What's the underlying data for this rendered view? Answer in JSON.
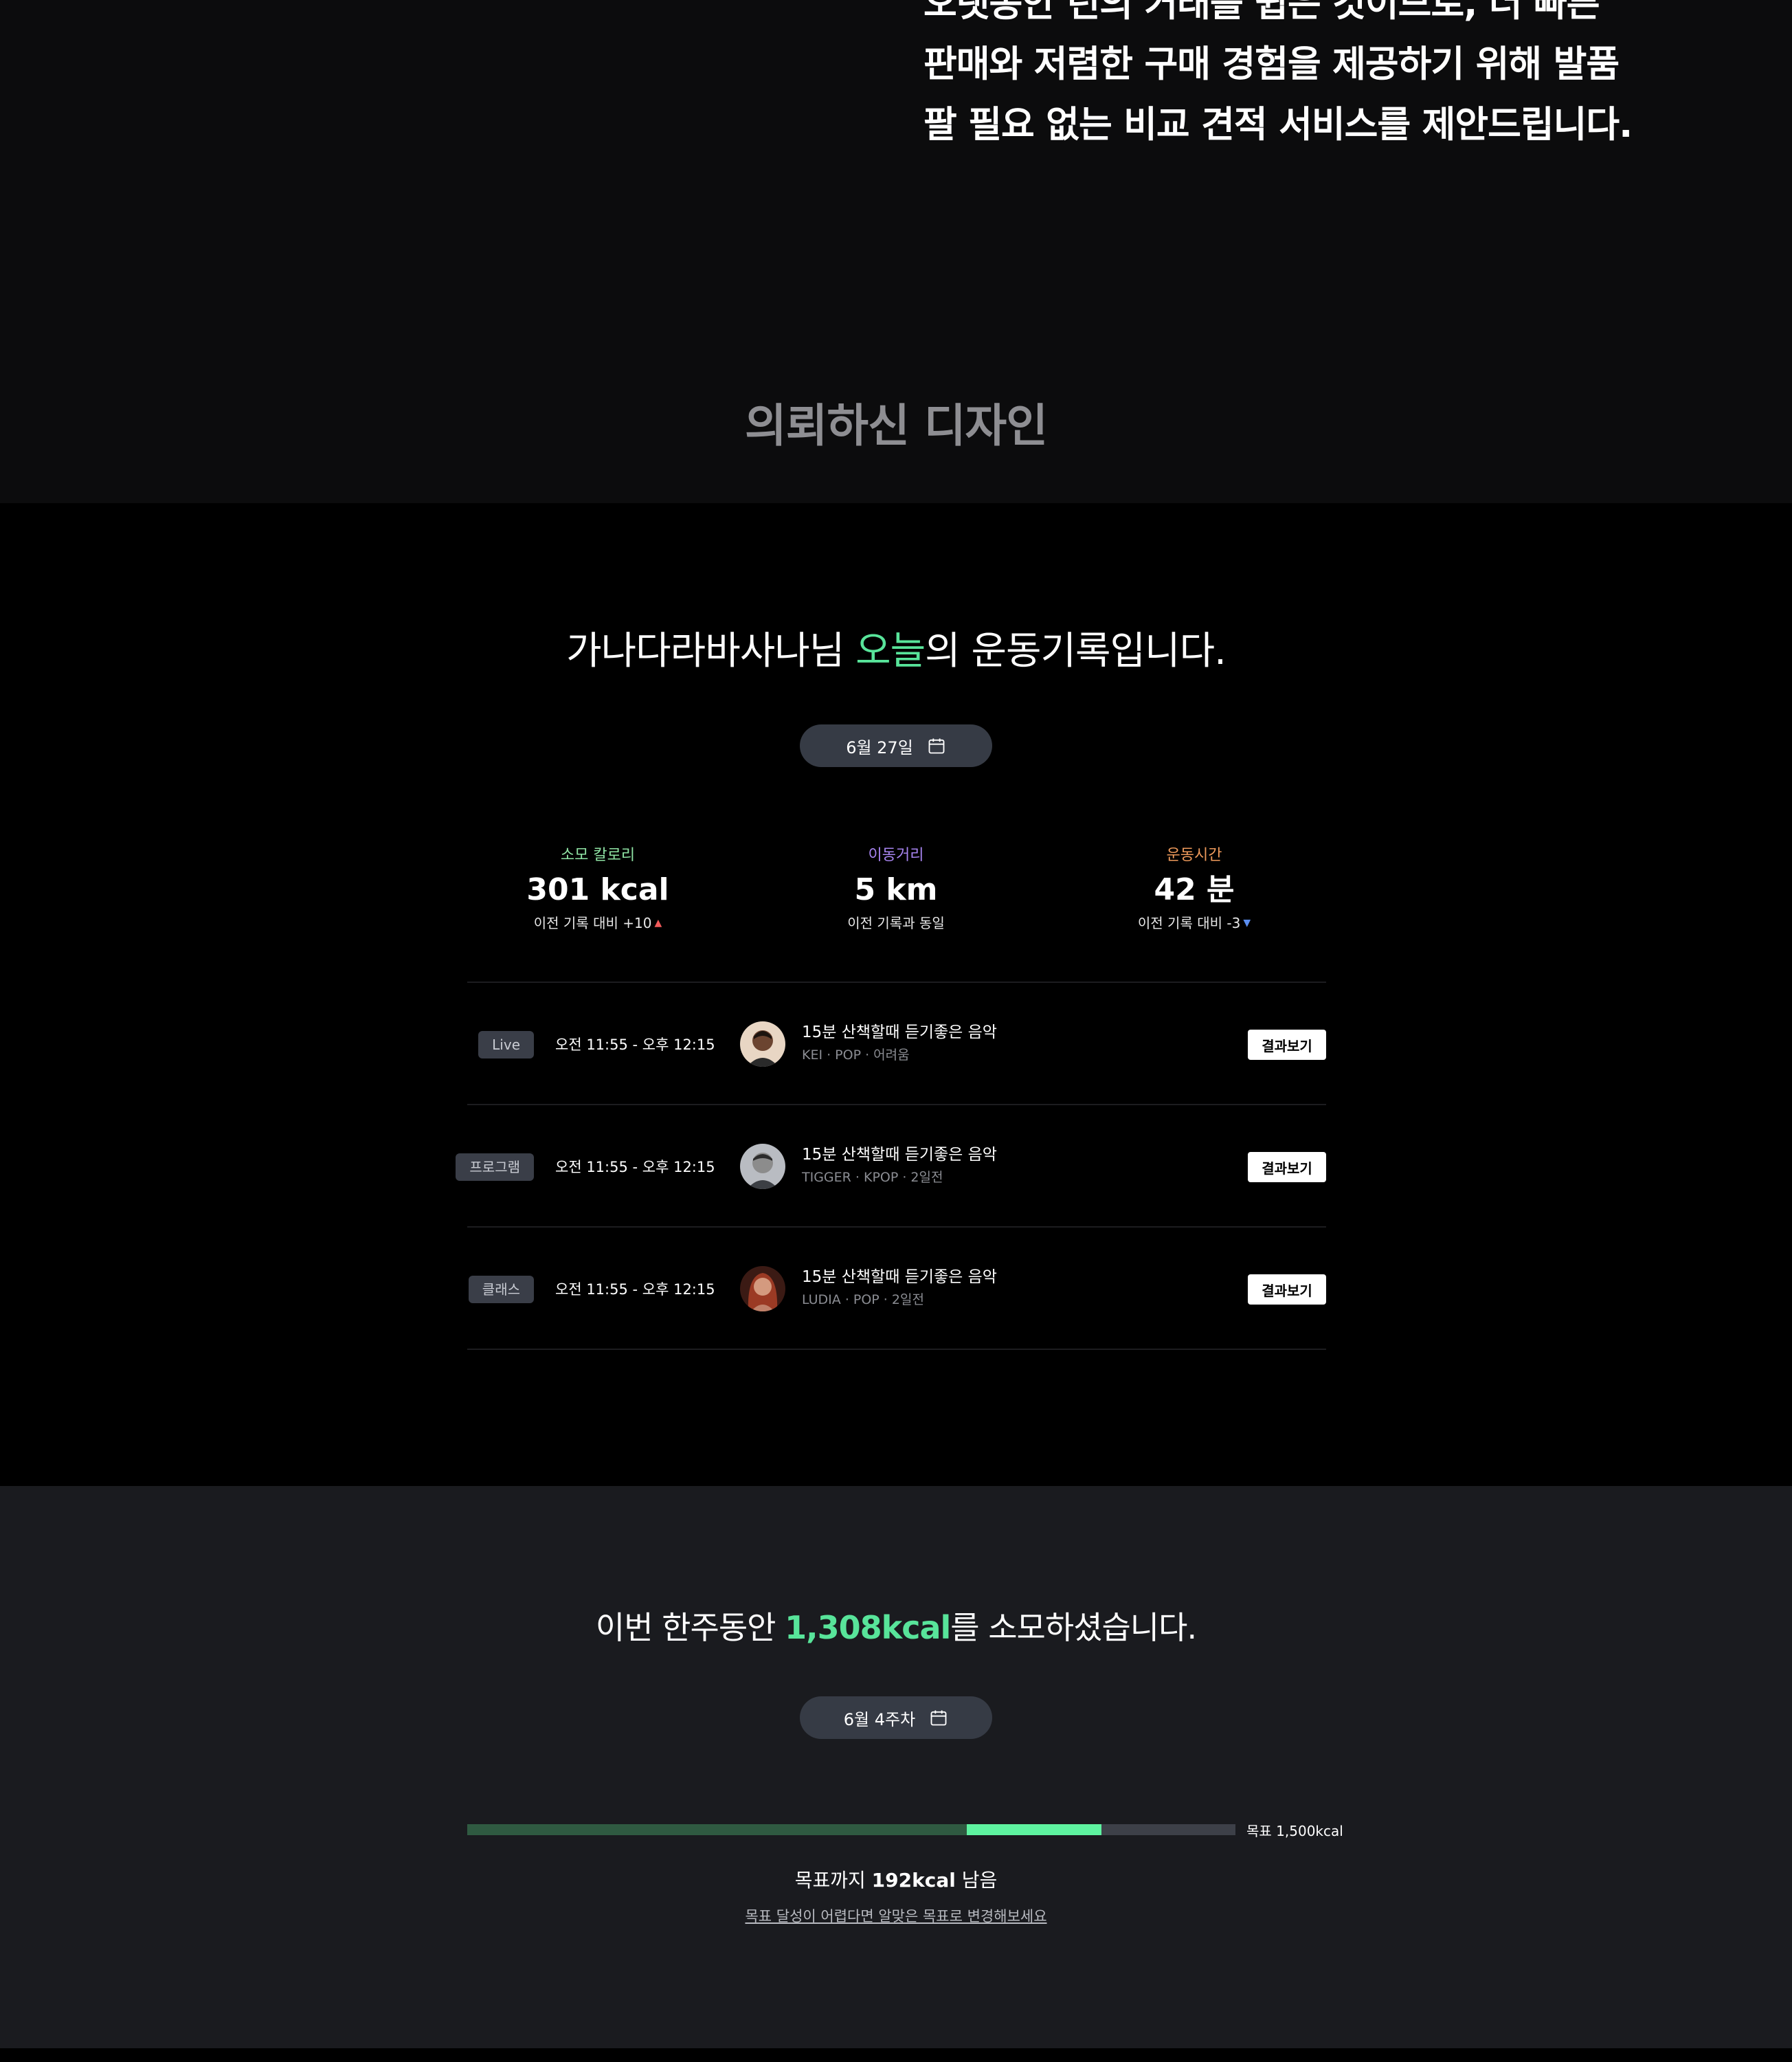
{
  "intro": {
    "lines": [
      "오랫동안 던의 거래를 쉽은 것이므로, 더 빠른",
      "판매와 저렴한 구매 경험을 제공하기 위해 발품",
      "팔 필요 없는 비교 견적 서비스를 제안드립니다."
    ]
  },
  "section_title": "의뢰하신 디자인",
  "today": {
    "heading_prefix": "가나다라바사나님 ",
    "heading_accent": "오늘",
    "heading_suffix": "의 운동기록입니다.",
    "date_label": "6월 27일",
    "stats": [
      {
        "label": "소모 칼로리",
        "value": "301 kcal",
        "sub": "이전 기록 대비 +10",
        "trend": "up",
        "color": "#8fe3a4"
      },
      {
        "label": "이동거리",
        "value": "5 km",
        "sub": "이전 기록과 동일",
        "trend": "none",
        "color": "#a784f0"
      },
      {
        "label": "운동시간",
        "value": "42 분",
        "sub": "이전 기록 대비 -3",
        "trend": "down",
        "color": "#ee9a5b"
      }
    ],
    "trend_up_glyph": "▲",
    "trend_down_glyph": "▼",
    "records": [
      {
        "tag": "Live",
        "time": "오전 11:55 - 오후 12:15",
        "title": "15분 산책할때 듣기좋은 음악",
        "meta": "KEI · POP · 어려움",
        "button": "결과보기",
        "avatar": "avatar-1"
      },
      {
        "tag": "프로그램",
        "time": "오전 11:55 - 오후 12:15",
        "title": "15분 산책할때 듣기좋은 음악",
        "meta": "TIGGER · KPOP · 2일전",
        "button": "결과보기",
        "avatar": "avatar-2"
      },
      {
        "tag": "클래스",
        "time": "오전 11:55 - 오후 12:15",
        "title": "15분 산책할때 듣기좋은 음악",
        "meta": "LUDIA · POP · 2일전",
        "button": "결과보기",
        "avatar": "avatar-3"
      }
    ]
  },
  "week": {
    "heading_prefix": "이번 한주동안 ",
    "heading_accent": "1,308kcal",
    "heading_suffix": "를 소모하셨습니다.",
    "week_label": "6월 4주차",
    "goal_label": "목표 1,500kcal",
    "progress": {
      "previous_fraction": 0.6504,
      "today_fraction": 0.1754
    },
    "remain_prefix": "목표까지 ",
    "remain_value": "192kcal",
    "remain_suffix": " 남음",
    "change_link": "목표 달성이 어렵다면 알맞은 목표로 변경해보세요"
  },
  "colors": {
    "accent_green": "#58e49a",
    "progress_previous": "#2f5a41",
    "progress_today": "#5ef3a0",
    "pill_bg": "#363b45"
  },
  "icons": {
    "calendar": "calendar-icon",
    "trend_up": "triangle-up-icon",
    "trend_down": "triangle-down-icon"
  }
}
